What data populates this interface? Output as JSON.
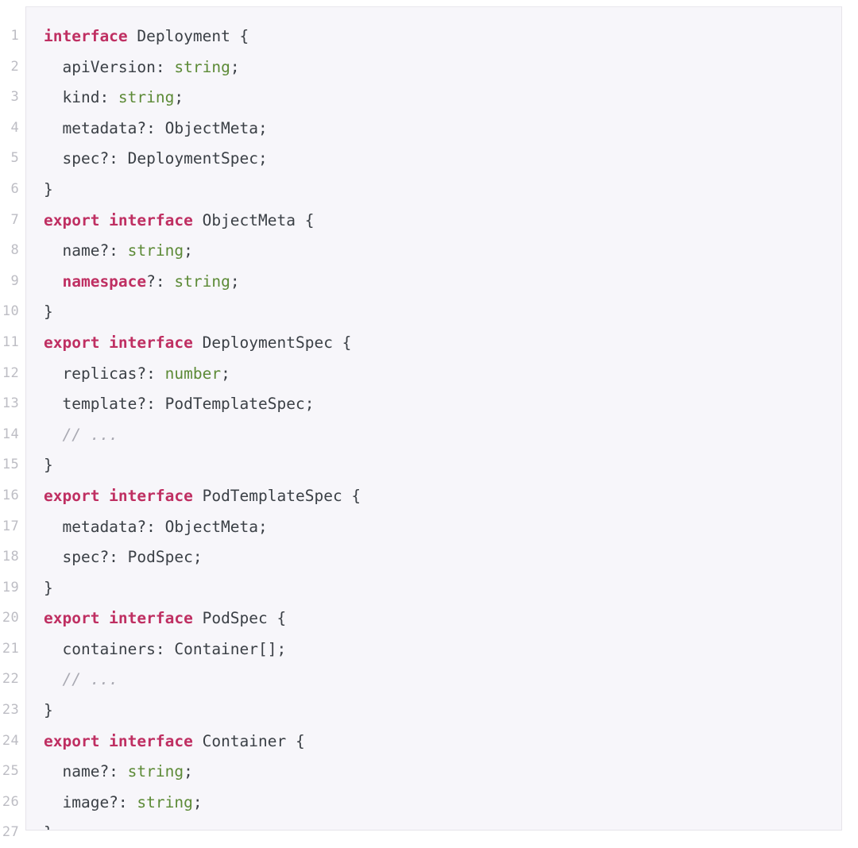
{
  "editor": {
    "language": "typescript",
    "background": "#f7f6fa",
    "page_background": "#ffffff",
    "border_color": "#e6e4ea",
    "line_number_color": "#bdbdc4",
    "total_lines": 27,
    "colors": {
      "keyword": "#bf2f62",
      "builtin_type": "#5c8a36",
      "identifier": "#3b4046",
      "comment": "#a9a9b2"
    },
    "line_numbers": [
      "1",
      "2",
      "3",
      "4",
      "5",
      "6",
      "7",
      "8",
      "9",
      "10",
      "11",
      "12",
      "13",
      "14",
      "15",
      "16",
      "17",
      "18",
      "19",
      "20",
      "21",
      "22",
      "23",
      "24",
      "25",
      "26",
      "27"
    ],
    "lines": [
      {
        "n": "1",
        "text": "interface Deployment {",
        "tokens": [
          {
            "t": "interface",
            "c": "kw"
          },
          {
            "t": " Deployment {",
            "c": "id"
          }
        ]
      },
      {
        "n": "2",
        "text": "  apiVersion: string;",
        "tokens": [
          {
            "t": "  apiVersion: ",
            "c": "id"
          },
          {
            "t": "string",
            "c": "typ"
          },
          {
            "t": ";",
            "c": "id"
          }
        ]
      },
      {
        "n": "3",
        "text": "  kind: string;",
        "tokens": [
          {
            "t": "  kind: ",
            "c": "id"
          },
          {
            "t": "string",
            "c": "typ"
          },
          {
            "t": ";",
            "c": "id"
          }
        ]
      },
      {
        "n": "4",
        "text": "  metadata?: ObjectMeta;",
        "tokens": [
          {
            "t": "  metadata?: ObjectMeta;",
            "c": "id"
          }
        ]
      },
      {
        "n": "5",
        "text": "  spec?: DeploymentSpec;",
        "tokens": [
          {
            "t": "  spec?: DeploymentSpec;",
            "c": "id"
          }
        ]
      },
      {
        "n": "6",
        "text": "}",
        "tokens": [
          {
            "t": "}",
            "c": "id"
          }
        ]
      },
      {
        "n": "7",
        "text": "export interface ObjectMeta {",
        "tokens": [
          {
            "t": "export interface",
            "c": "kw"
          },
          {
            "t": " ObjectMeta {",
            "c": "id"
          }
        ]
      },
      {
        "n": "8",
        "text": "  name?: string;",
        "tokens": [
          {
            "t": "  name?: ",
            "c": "id"
          },
          {
            "t": "string",
            "c": "typ"
          },
          {
            "t": ";",
            "c": "id"
          }
        ]
      },
      {
        "n": "9",
        "text": "  namespace?: string;",
        "tokens": [
          {
            "t": "  ",
            "c": "id"
          },
          {
            "t": "namespace",
            "c": "kw"
          },
          {
            "t": "?: ",
            "c": "id"
          },
          {
            "t": "string",
            "c": "typ"
          },
          {
            "t": ";",
            "c": "id"
          }
        ]
      },
      {
        "n": "10",
        "text": "}",
        "tokens": [
          {
            "t": "}",
            "c": "id"
          }
        ]
      },
      {
        "n": "11",
        "text": "export interface DeploymentSpec {",
        "tokens": [
          {
            "t": "export interface",
            "c": "kw"
          },
          {
            "t": " DeploymentSpec {",
            "c": "id"
          }
        ]
      },
      {
        "n": "12",
        "text": "  replicas?: number;",
        "tokens": [
          {
            "t": "  replicas?: ",
            "c": "id"
          },
          {
            "t": "number",
            "c": "typ"
          },
          {
            "t": ";",
            "c": "id"
          }
        ]
      },
      {
        "n": "13",
        "text": "  template?: PodTemplateSpec;",
        "tokens": [
          {
            "t": "  template?: PodTemplateSpec;",
            "c": "id"
          }
        ]
      },
      {
        "n": "14",
        "text": "  // ...",
        "tokens": [
          {
            "t": "  ",
            "c": "id"
          },
          {
            "t": "// ...",
            "c": "cmt"
          }
        ]
      },
      {
        "n": "15",
        "text": "}",
        "tokens": [
          {
            "t": "}",
            "c": "id"
          }
        ]
      },
      {
        "n": "16",
        "text": "export interface PodTemplateSpec {",
        "tokens": [
          {
            "t": "export interface",
            "c": "kw"
          },
          {
            "t": " PodTemplateSpec {",
            "c": "id"
          }
        ]
      },
      {
        "n": "17",
        "text": "  metadata?: ObjectMeta;",
        "tokens": [
          {
            "t": "  metadata?: ObjectMeta;",
            "c": "id"
          }
        ]
      },
      {
        "n": "18",
        "text": "  spec?: PodSpec;",
        "tokens": [
          {
            "t": "  spec?: PodSpec;",
            "c": "id"
          }
        ]
      },
      {
        "n": "19",
        "text": "}",
        "tokens": [
          {
            "t": "}",
            "c": "id"
          }
        ]
      },
      {
        "n": "20",
        "text": "export interface PodSpec {",
        "tokens": [
          {
            "t": "export interface",
            "c": "kw"
          },
          {
            "t": " PodSpec {",
            "c": "id"
          }
        ]
      },
      {
        "n": "21",
        "text": "  containers: Container[];",
        "tokens": [
          {
            "t": "  containers: Container[];",
            "c": "id"
          }
        ]
      },
      {
        "n": "22",
        "text": "  // ...",
        "tokens": [
          {
            "t": "  ",
            "c": "id"
          },
          {
            "t": "// ...",
            "c": "cmt"
          }
        ]
      },
      {
        "n": "23",
        "text": "}",
        "tokens": [
          {
            "t": "}",
            "c": "id"
          }
        ]
      },
      {
        "n": "24",
        "text": "export interface Container {",
        "tokens": [
          {
            "t": "export interface",
            "c": "kw"
          },
          {
            "t": " Container {",
            "c": "id"
          }
        ]
      },
      {
        "n": "25",
        "text": "  name?: string;",
        "tokens": [
          {
            "t": "  name?: ",
            "c": "id"
          },
          {
            "t": "string",
            "c": "typ"
          },
          {
            "t": ";",
            "c": "id"
          }
        ]
      },
      {
        "n": "26",
        "text": "  image?: string;",
        "tokens": [
          {
            "t": "  image?: ",
            "c": "id"
          },
          {
            "t": "string",
            "c": "typ"
          },
          {
            "t": ";",
            "c": "id"
          }
        ]
      },
      {
        "n": "27",
        "text": "}",
        "tokens": [
          {
            "t": "}",
            "c": "id"
          }
        ]
      }
    ]
  }
}
